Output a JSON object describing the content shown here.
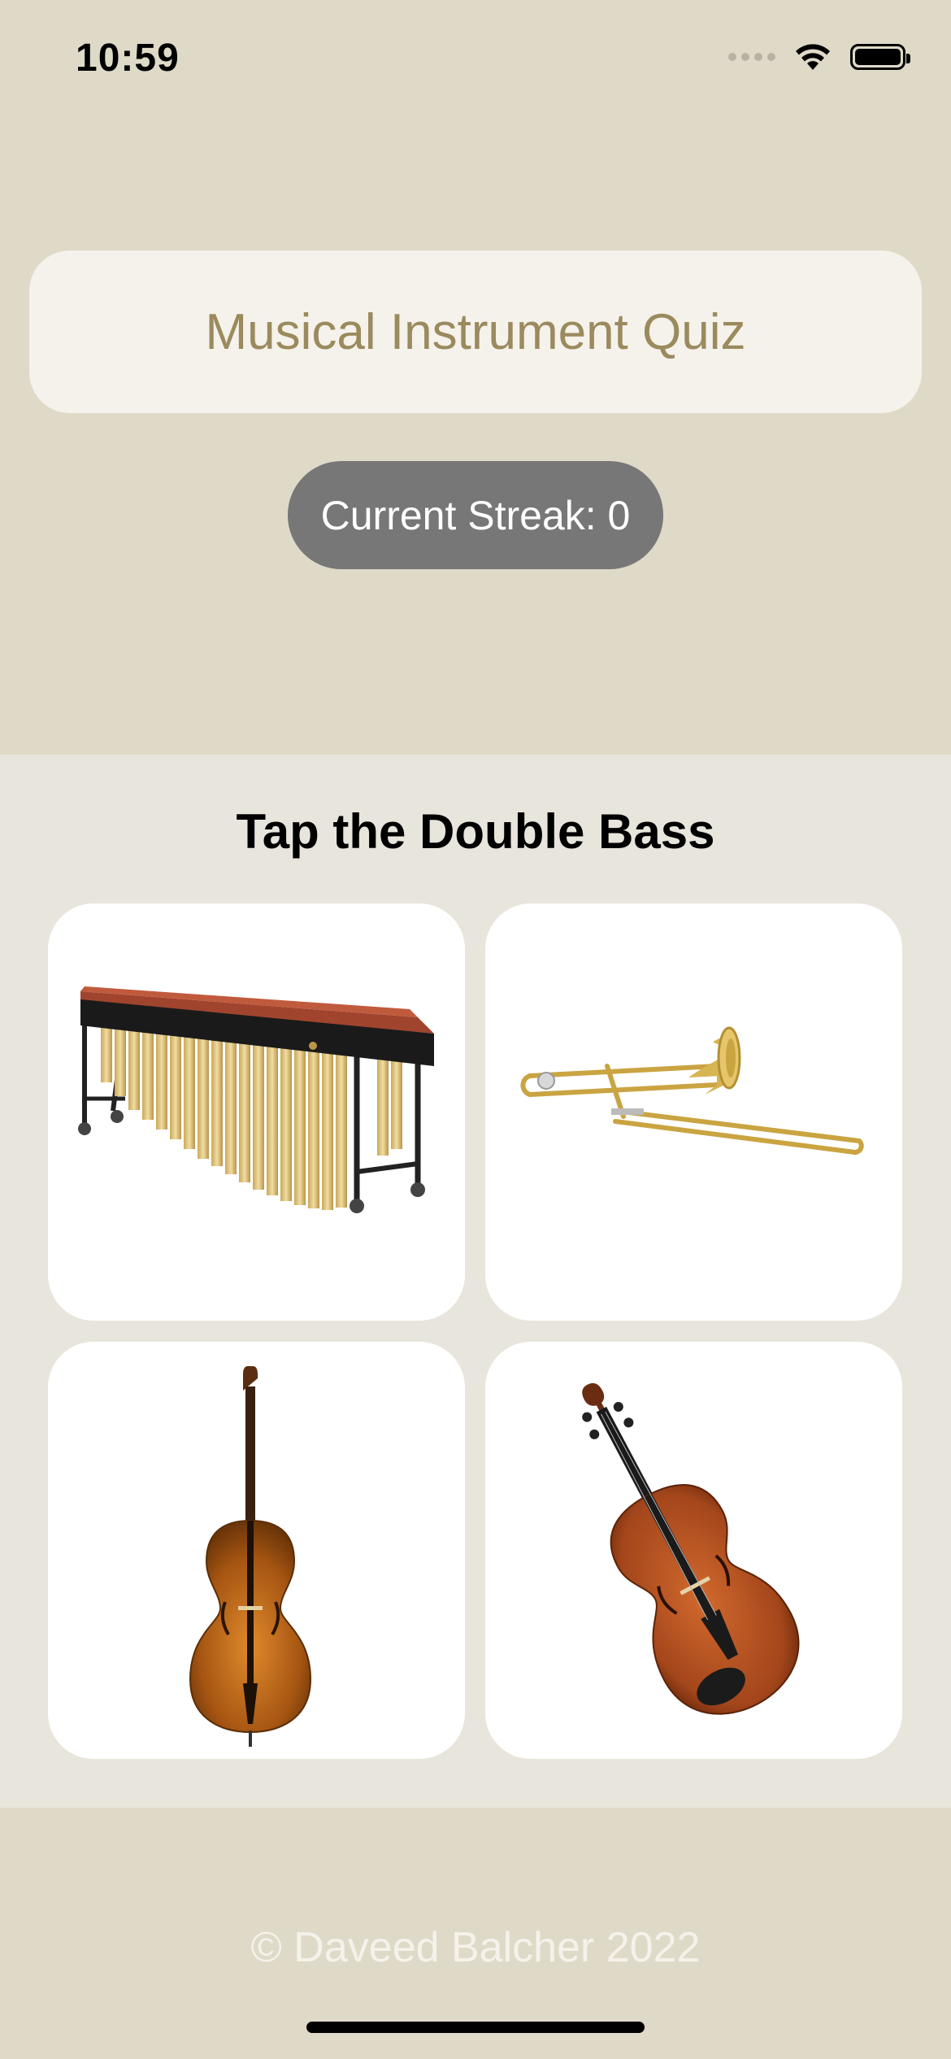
{
  "status_bar": {
    "time": "10:59",
    "icons": [
      "cellular-signal-icon",
      "wifi-icon",
      "battery-icon"
    ]
  },
  "header": {
    "title": "Musical Instrument Quiz",
    "streak": "Current Streak: 0"
  },
  "quiz": {
    "prompt": "Tap the Double Bass",
    "choices": [
      {
        "icon": "marimba-image"
      },
      {
        "icon": "trombone-image"
      },
      {
        "icon": "double-bass-image"
      },
      {
        "icon": "violin-image"
      }
    ]
  },
  "footer": {
    "copyright": "© Daveed Balcher 2022"
  },
  "colors": {
    "background": "#dfdac8",
    "panel": "#e8e5dc",
    "title_text": "#9b8a5e",
    "streak_pill": "#777777"
  }
}
